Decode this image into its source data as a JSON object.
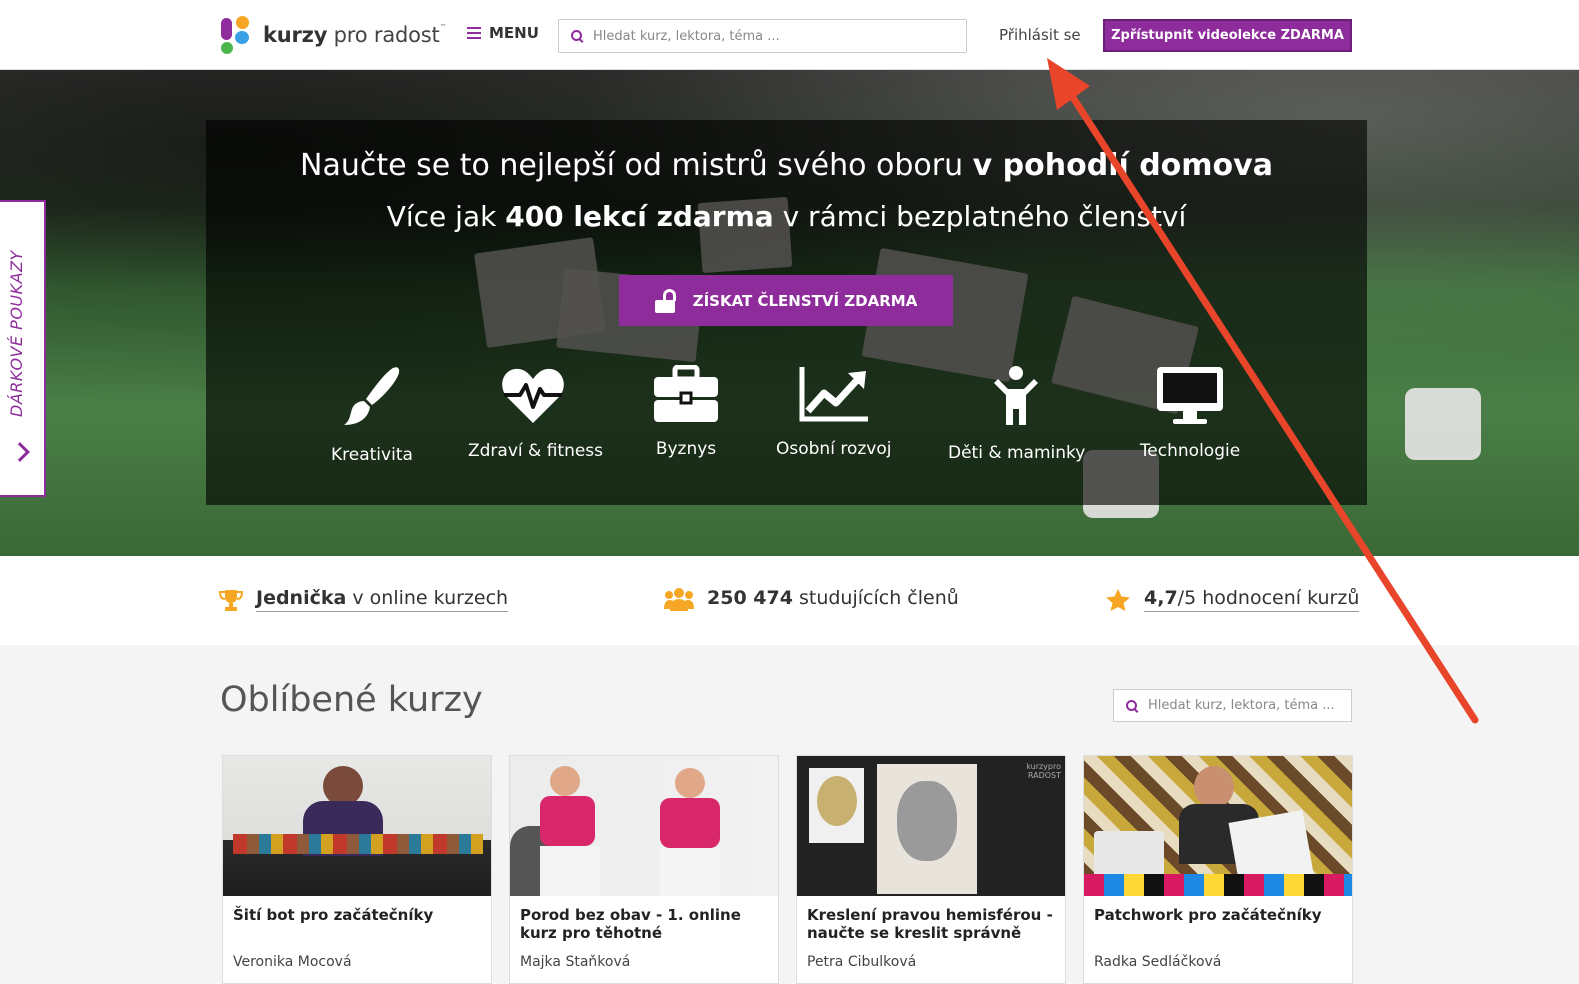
{
  "header": {
    "logo_bold": "kurzy",
    "logo_rest": " pro radost",
    "logo_tm": "™",
    "menu_label": "MENU",
    "search_placeholder": "Hledat kurz, lektora, téma ...",
    "login_label": "Přihlásit se",
    "cta_label": "Zpřístupnit videolekce ZDARMA"
  },
  "hero": {
    "line1_a": "Naučte se to nejlepší od mistrů svého oboru ",
    "line1_b": "v pohodlí domova",
    "line2_a": "Více jak ",
    "line2_b": "400 lekcí zdarma",
    "line2_c": " v rámci bezplatného členství",
    "cta_label": "ZÍSKAT ČLENSTVÍ ZDARMA",
    "categories": [
      {
        "label": "Kreativita",
        "icon": "brush-icon"
      },
      {
        "label": "Zdraví & fitness",
        "icon": "heartbeat-icon"
      },
      {
        "label": "Byznys",
        "icon": "briefcase-icon"
      },
      {
        "label": "Osobní rozvoj",
        "icon": "chart-line-icon"
      },
      {
        "label": "Děti & maminky",
        "icon": "child-icon"
      },
      {
        "label": "Technologie",
        "icon": "monitor-icon"
      }
    ]
  },
  "side_tab": {
    "label": "DÁRKOVÉ POUKAZY"
  },
  "stats": {
    "s1_bold": "Jednička",
    "s1_rest": " v online kurzech",
    "s2_bold": "250 474",
    "s2_rest": " studujících členů",
    "s3_bold": "4,7",
    "s3_rest": "/5 hodnocení kurzů"
  },
  "courses": {
    "title": "Oblíbené kurzy",
    "search_placeholder": "Hledat kurz, lektora, téma ...",
    "items": [
      {
        "title": "Šití bot pro začátečníky",
        "author": "Veronika Mocová"
      },
      {
        "title": "Porod bez obav - 1. online kurz pro těhotné",
        "author": "Majka Staňková"
      },
      {
        "title": "Kreslení pravou hemisférou - naučte se kreslit správně",
        "author": "Petra Cibulková"
      },
      {
        "title": "Patchwork pro začátečníky",
        "author": "Radka Sedláčková"
      }
    ],
    "thumb3_watermark_top": "kurzypro",
    "thumb3_watermark_bottom": "RADOST"
  },
  "colors": {
    "brand": "#8e2c9c",
    "accent_orange": "#f6a623",
    "annotation_arrow": "#e8452a"
  }
}
